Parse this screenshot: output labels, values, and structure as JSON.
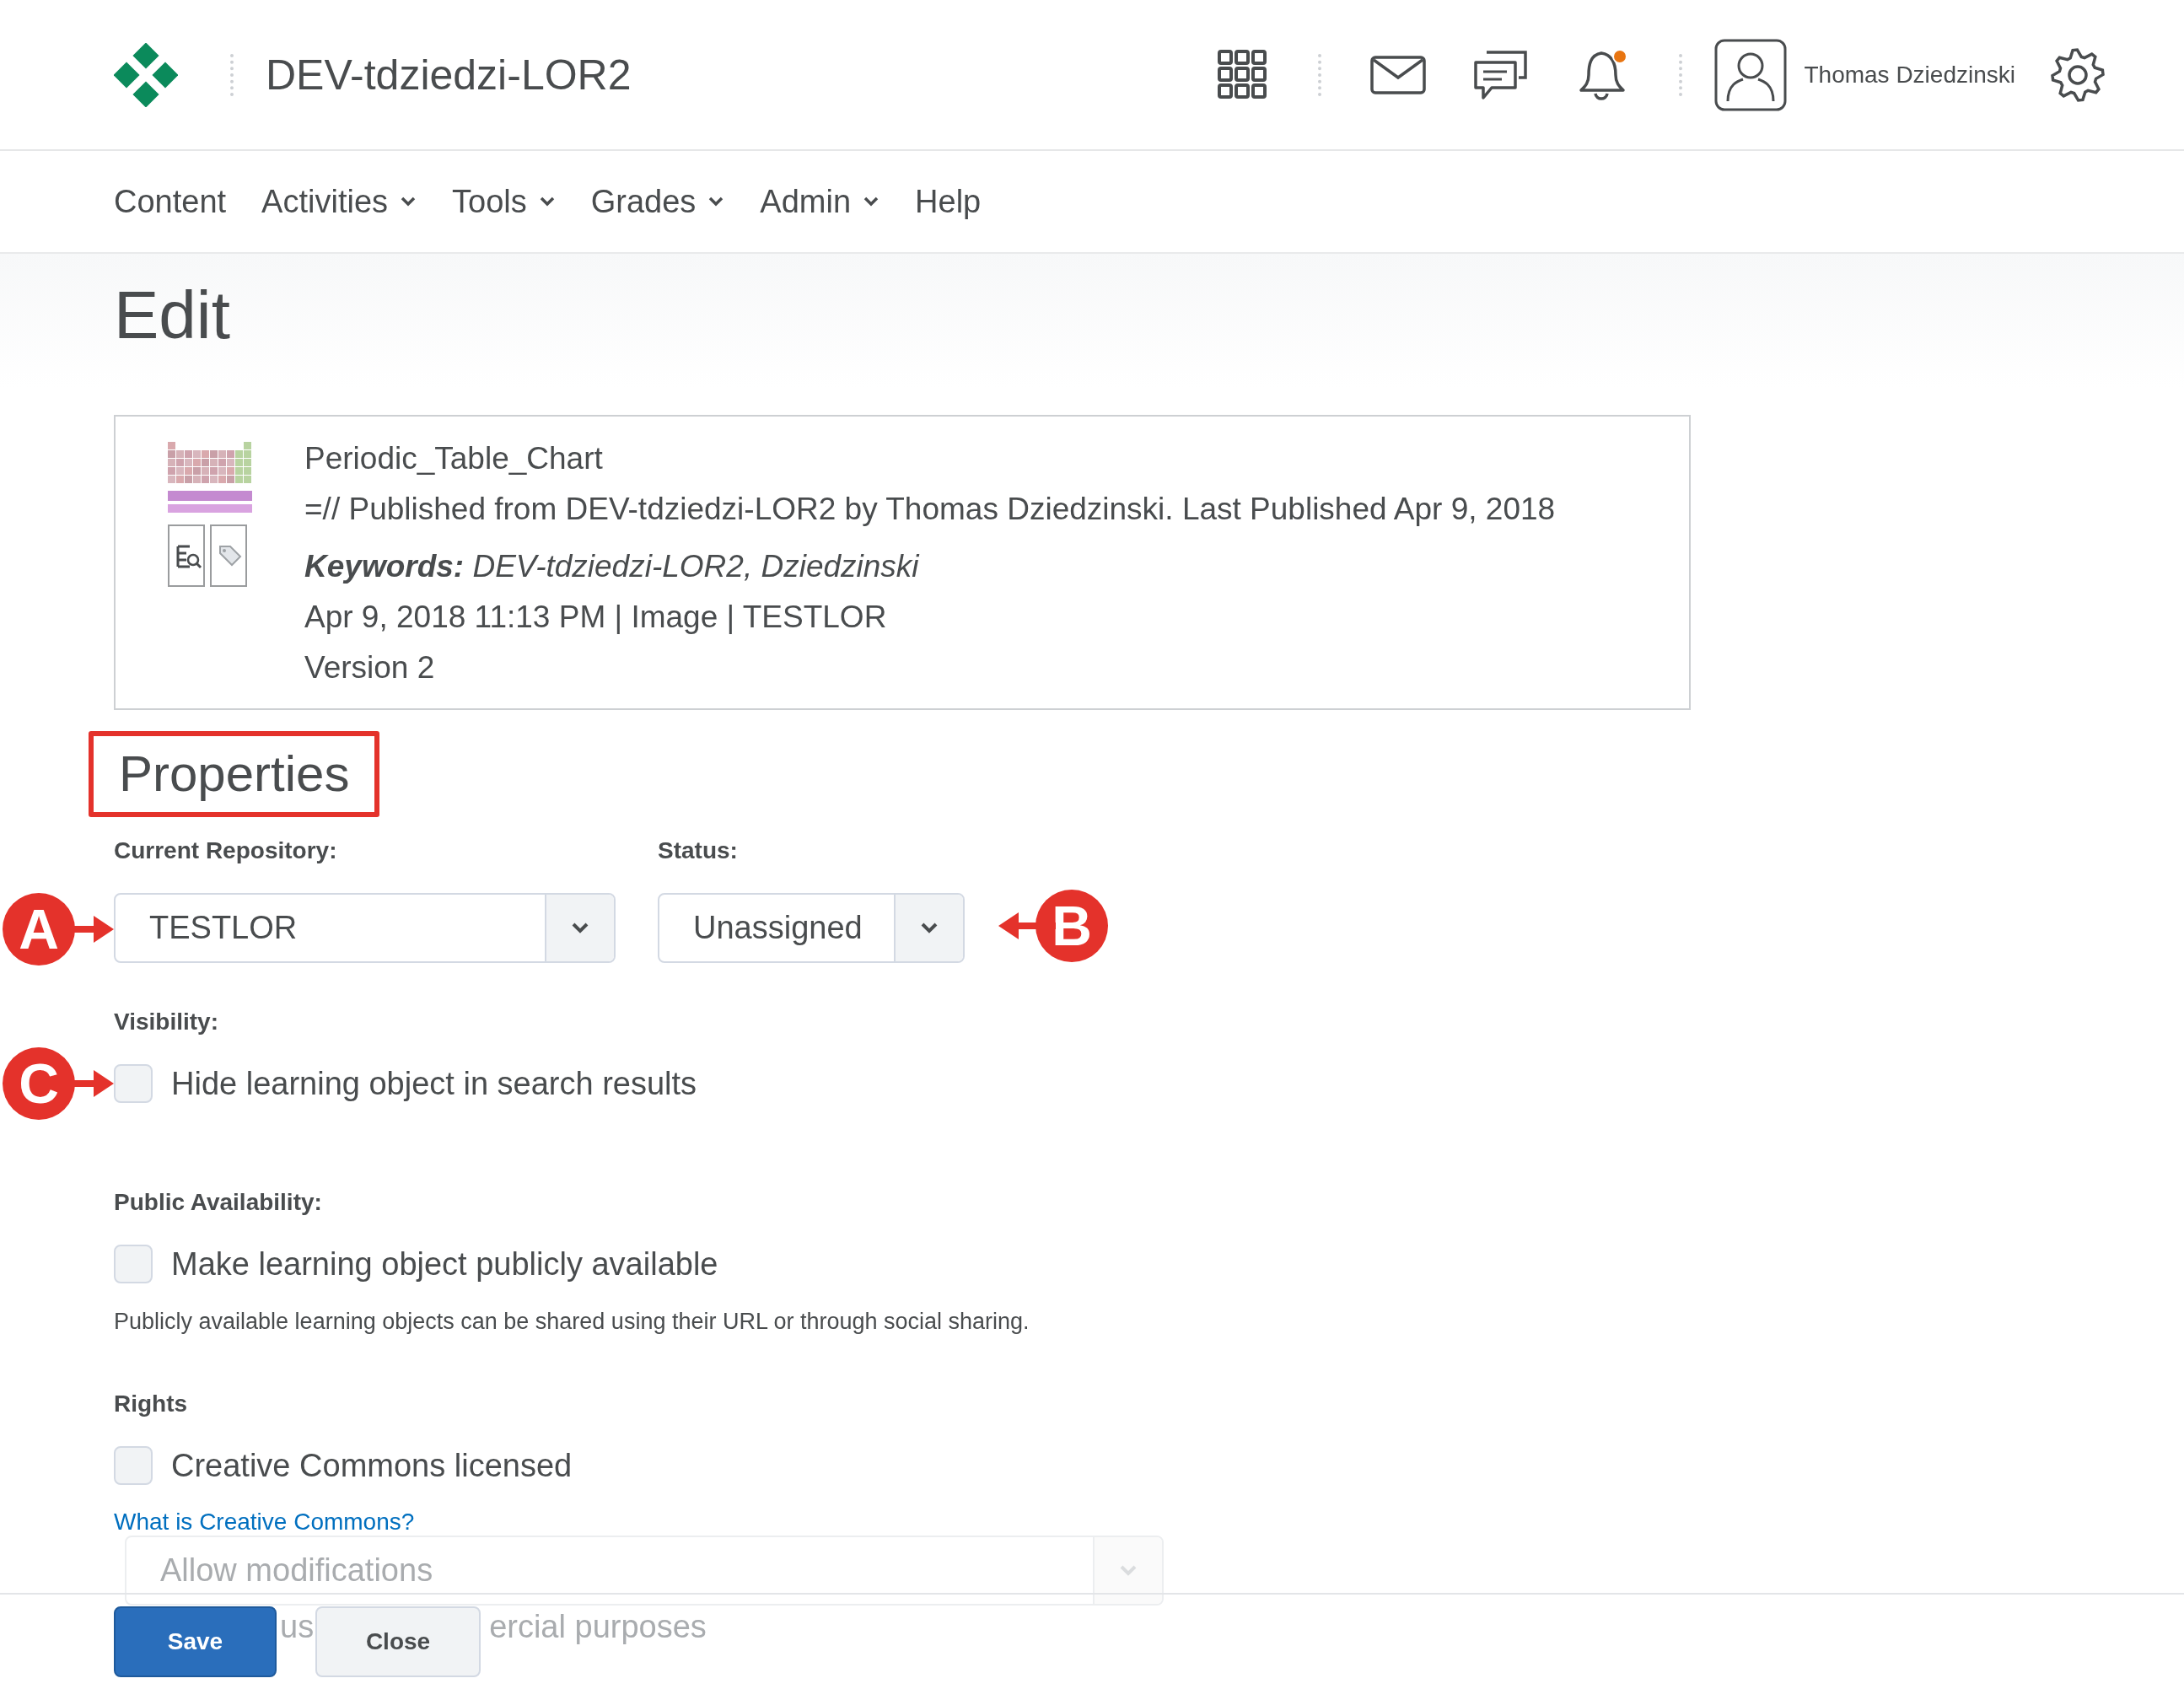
{
  "header": {
    "site_title": "DEV-tdziedzi-LOR2",
    "user_name": "Thomas Dziedzinski",
    "notification_dot": true
  },
  "nav": [
    {
      "label": "Content",
      "has_menu": false
    },
    {
      "label": "Activities",
      "has_menu": true
    },
    {
      "label": "Tools",
      "has_menu": true
    },
    {
      "label": "Grades",
      "has_menu": true
    },
    {
      "label": "Admin",
      "has_menu": true
    },
    {
      "label": "Help",
      "has_menu": false
    }
  ],
  "page_title": "Edit",
  "item": {
    "title": "Periodic_Table_Chart",
    "published": "=// Published from DEV-tdziedzi-LOR2 by Thomas Dziedzinski. Last Published Apr 9, 2018",
    "keywords": "**Keywords:** DEV-tdziedzi-LOR2, Dziedzinski",
    "meta": "Apr 9, 2018 11:13 PM | Image | TESTLOR",
    "version": "Version 2"
  },
  "properties": {
    "heading": "Properties",
    "highlighted": true
  },
  "fields": [
    {
      "label": "Current Repository:",
      "value": "TESTLOR",
      "annotation": {
        "letter": "A",
        "kind": "rightward"
      }
    },
    {
      "label": "Status:",
      "value": "Unassigned",
      "annotation": {
        "letter": "B",
        "kind": "leftward"
      }
    }
  ],
  "visibility": {
    "label": "Visibility:",
    "option": {
      "text": "Hide learning object in search results",
      "checked": false
    },
    "annotation": {
      "letter": "C",
      "kind": "rightward"
    }
  },
  "public_availability": {
    "label": "Public Availability:",
    "option": {
      "text": "Make learning object publicly available",
      "checked": false
    },
    "help": "Publicly available learning objects can be shared using their URL or through social sharing."
  },
  "rights": {
    "label": "Rights",
    "option": {
      "text": "Creative Commons licensed",
      "checked": false
    },
    "link": "What is Creative Commons?",
    "modifications": {
      "value": "Allow modifications",
      "disabled": true
    },
    "partial_text": [
      "us",
      "ercial purposes"
    ]
  },
  "footer": {
    "buttons": [
      {
        "label": "Save",
        "kind": "primary"
      },
      {
        "label": "Close",
        "kind": "secondary"
      }
    ]
  }
}
